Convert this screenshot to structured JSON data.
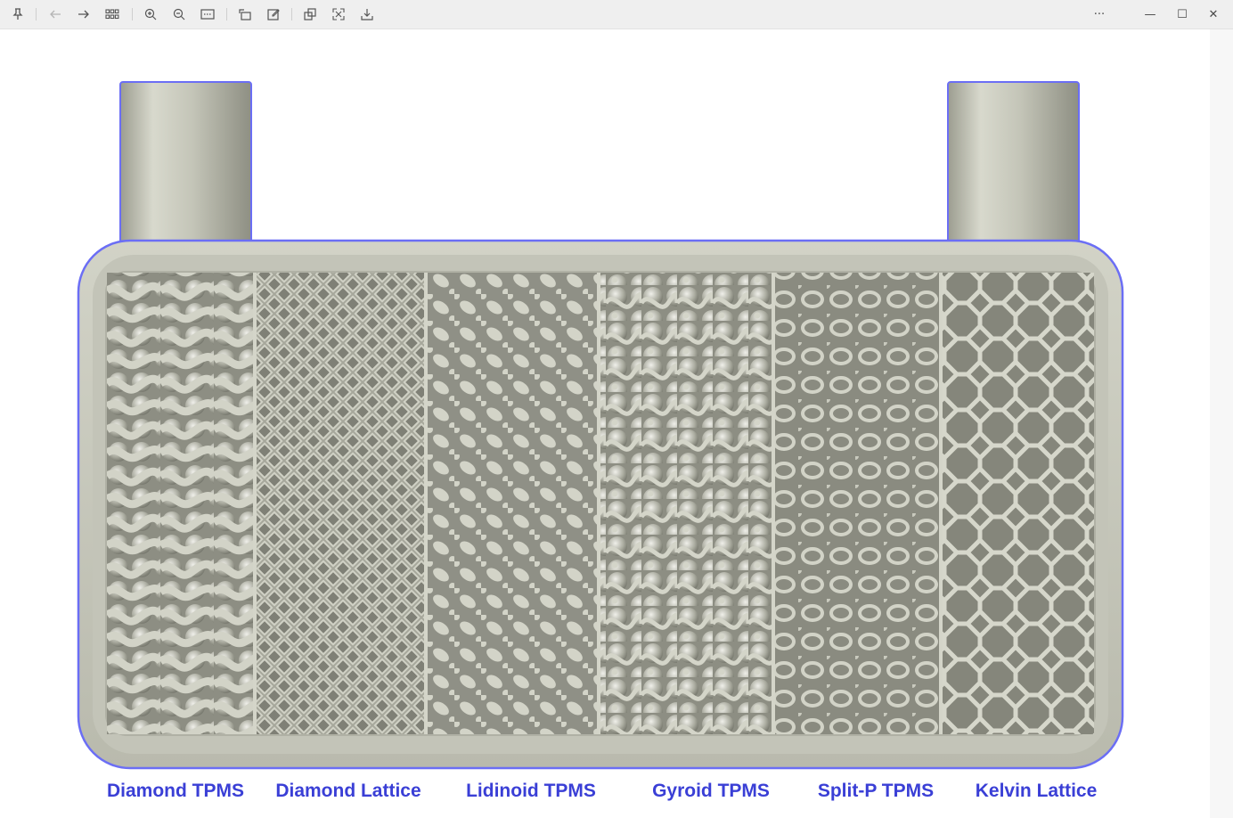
{
  "toolbar": {
    "left_icons": [
      "pin-icon",
      "back-arrow-icon",
      "forward-arrow-icon",
      "grid-view-icon",
      "zoom-in-icon",
      "zoom-out-icon",
      "fit-width-icon",
      "rotate-icon",
      "edit-icon",
      "copy-icon",
      "fullscreen-icon",
      "save-icon"
    ],
    "right_icons": [
      "more-icon",
      "minimize-icon",
      "maximize-icon",
      "close-icon"
    ],
    "more_glyph": "···",
    "minimize_glyph": "—",
    "maximize_glyph": "☐",
    "close_glyph": "✕"
  },
  "figure": {
    "labels": [
      "Diamond TPMS",
      "Diamond Lattice",
      "Lidinoid TPMS",
      "Gyroid TPMS",
      "Split-P TPMS",
      "Kelvin Lattice"
    ],
    "label_color": "#3a3fd6",
    "body_color": "#c9cabd",
    "outline_color": "#6b6ef5"
  }
}
